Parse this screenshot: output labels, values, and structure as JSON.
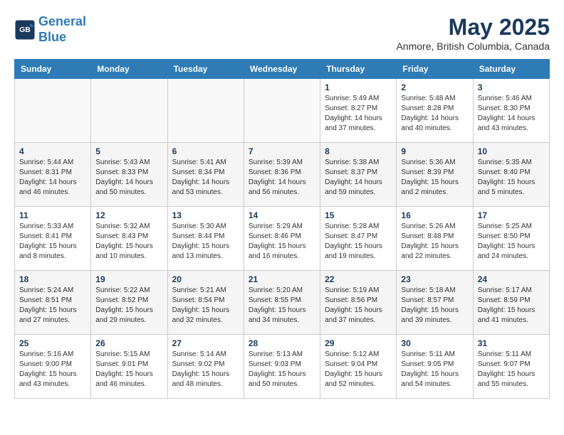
{
  "header": {
    "logo_line1": "General",
    "logo_line2": "Blue",
    "month_title": "May 2025",
    "location": "Anmore, British Columbia, Canada"
  },
  "columns": [
    "Sunday",
    "Monday",
    "Tuesday",
    "Wednesday",
    "Thursday",
    "Friday",
    "Saturday"
  ],
  "weeks": [
    [
      {
        "day": "",
        "info": ""
      },
      {
        "day": "",
        "info": ""
      },
      {
        "day": "",
        "info": ""
      },
      {
        "day": "",
        "info": ""
      },
      {
        "day": "1",
        "info": "Sunrise: 5:49 AM\nSunset: 8:27 PM\nDaylight: 14 hours\nand 37 minutes."
      },
      {
        "day": "2",
        "info": "Sunrise: 5:48 AM\nSunset: 8:28 PM\nDaylight: 14 hours\nand 40 minutes."
      },
      {
        "day": "3",
        "info": "Sunrise: 5:46 AM\nSunset: 8:30 PM\nDaylight: 14 hours\nand 43 minutes."
      }
    ],
    [
      {
        "day": "4",
        "info": "Sunrise: 5:44 AM\nSunset: 8:31 PM\nDaylight: 14 hours\nand 46 minutes."
      },
      {
        "day": "5",
        "info": "Sunrise: 5:43 AM\nSunset: 8:33 PM\nDaylight: 14 hours\nand 50 minutes."
      },
      {
        "day": "6",
        "info": "Sunrise: 5:41 AM\nSunset: 8:34 PM\nDaylight: 14 hours\nand 53 minutes."
      },
      {
        "day": "7",
        "info": "Sunrise: 5:39 AM\nSunset: 8:36 PM\nDaylight: 14 hours\nand 56 minutes."
      },
      {
        "day": "8",
        "info": "Sunrise: 5:38 AM\nSunset: 8:37 PM\nDaylight: 14 hours\nand 59 minutes."
      },
      {
        "day": "9",
        "info": "Sunrise: 5:36 AM\nSunset: 8:39 PM\nDaylight: 15 hours\nand 2 minutes."
      },
      {
        "day": "10",
        "info": "Sunrise: 5:35 AM\nSunset: 8:40 PM\nDaylight: 15 hours\nand 5 minutes."
      }
    ],
    [
      {
        "day": "11",
        "info": "Sunrise: 5:33 AM\nSunset: 8:41 PM\nDaylight: 15 hours\nand 8 minutes."
      },
      {
        "day": "12",
        "info": "Sunrise: 5:32 AM\nSunset: 8:43 PM\nDaylight: 15 hours\nand 10 minutes."
      },
      {
        "day": "13",
        "info": "Sunrise: 5:30 AM\nSunset: 8:44 PM\nDaylight: 15 hours\nand 13 minutes."
      },
      {
        "day": "14",
        "info": "Sunrise: 5:29 AM\nSunset: 8:46 PM\nDaylight: 15 hours\nand 16 minutes."
      },
      {
        "day": "15",
        "info": "Sunrise: 5:28 AM\nSunset: 8:47 PM\nDaylight: 15 hours\nand 19 minutes."
      },
      {
        "day": "16",
        "info": "Sunrise: 5:26 AM\nSunset: 8:48 PM\nDaylight: 15 hours\nand 22 minutes."
      },
      {
        "day": "17",
        "info": "Sunrise: 5:25 AM\nSunset: 8:50 PM\nDaylight: 15 hours\nand 24 minutes."
      }
    ],
    [
      {
        "day": "18",
        "info": "Sunrise: 5:24 AM\nSunset: 8:51 PM\nDaylight: 15 hours\nand 27 minutes."
      },
      {
        "day": "19",
        "info": "Sunrise: 5:22 AM\nSunset: 8:52 PM\nDaylight: 15 hours\nand 29 minutes."
      },
      {
        "day": "20",
        "info": "Sunrise: 5:21 AM\nSunset: 8:54 PM\nDaylight: 15 hours\nand 32 minutes."
      },
      {
        "day": "21",
        "info": "Sunrise: 5:20 AM\nSunset: 8:55 PM\nDaylight: 15 hours\nand 34 minutes."
      },
      {
        "day": "22",
        "info": "Sunrise: 5:19 AM\nSunset: 8:56 PM\nDaylight: 15 hours\nand 37 minutes."
      },
      {
        "day": "23",
        "info": "Sunrise: 5:18 AM\nSunset: 8:57 PM\nDaylight: 15 hours\nand 39 minutes."
      },
      {
        "day": "24",
        "info": "Sunrise: 5:17 AM\nSunset: 8:59 PM\nDaylight: 15 hours\nand 41 minutes."
      }
    ],
    [
      {
        "day": "25",
        "info": "Sunrise: 5:16 AM\nSunset: 9:00 PM\nDaylight: 15 hours\nand 43 minutes."
      },
      {
        "day": "26",
        "info": "Sunrise: 5:15 AM\nSunset: 9:01 PM\nDaylight: 15 hours\nand 46 minutes."
      },
      {
        "day": "27",
        "info": "Sunrise: 5:14 AM\nSunset: 9:02 PM\nDaylight: 15 hours\nand 48 minutes."
      },
      {
        "day": "28",
        "info": "Sunrise: 5:13 AM\nSunset: 9:03 PM\nDaylight: 15 hours\nand 50 minutes."
      },
      {
        "day": "29",
        "info": "Sunrise: 5:12 AM\nSunset: 9:04 PM\nDaylight: 15 hours\nand 52 minutes."
      },
      {
        "day": "30",
        "info": "Sunrise: 5:11 AM\nSunset: 9:05 PM\nDaylight: 15 hours\nand 54 minutes."
      },
      {
        "day": "31",
        "info": "Sunrise: 5:11 AM\nSunset: 9:07 PM\nDaylight: 15 hours\nand 55 minutes."
      }
    ]
  ]
}
